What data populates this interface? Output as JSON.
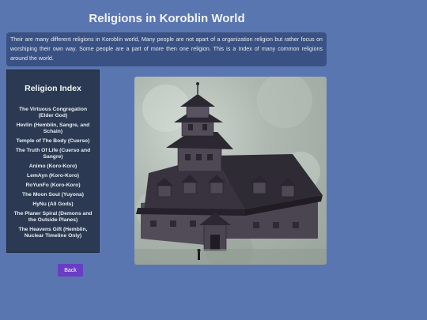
{
  "page": {
    "title": "Religions in Koroblin World",
    "intro": "Their are many different religions in Koroblin world, Many people are not apart of a organization religion but rather focus on worshiping their own way. Some people are a part of more then one religion. This is a Index of many common religions around the world."
  },
  "sidebar": {
    "title": "Religion Index",
    "items": [
      "The Virtuous Congregation (Elder God)",
      "Hevlin (Hemblin, Sangre, and Schain)",
      "Temple of The Body (Cuerso)",
      "The Truth Of Life (Cuerso and Sangre)",
      "Animo (Koro-Koro)",
      "LemAyn (Koro-Koro)",
      "RoYunFo (Koro-Koro)",
      "The Moon Soul (Yuyona)",
      "HyNu (All Gods)",
      "The Planer Spiral (Demons and the Outside Planes)",
      "The Heavens Gift (Hemblin, Nuclear Timeline Only)"
    ]
  },
  "image": {
    "subject": "temple-building",
    "background_color": "#aab4ac",
    "roof_color": "#2e2a33",
    "wall_color": "#4b4652"
  },
  "buttons": {
    "back_label": "Back"
  },
  "colors": {
    "page_bg": "#5a76b0",
    "panel_bg": "#3a5283",
    "sidebar_bg": "#2b3a52",
    "button_bg": "#6a3ec4"
  }
}
